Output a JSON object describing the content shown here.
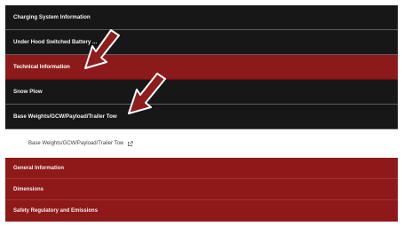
{
  "menu": {
    "items": [
      {
        "label": "Charging System Information"
      },
      {
        "label": "Under Hood Switched Battery ..."
      },
      {
        "label": "Technical Information"
      },
      {
        "label": "Snow Plow"
      },
      {
        "label": "Base Weights/GCW/Payload/Trailer Tow"
      }
    ]
  },
  "sublink": {
    "label": "Base Weights/GCW/Payload/Trailer Tow",
    "icon": "external-link-icon"
  },
  "sections": {
    "items": [
      {
        "label": "General Information"
      },
      {
        "label": "Dimensions"
      },
      {
        "label": "Safety Regulatory and Emissions"
      }
    ]
  },
  "annotations": {
    "arrow_color": "#8f1d1d",
    "arrow_outline": "#ffffff",
    "arrow_icon": "pointer-arrow-icon"
  },
  "colors": {
    "menu_bg": "#171717",
    "active_bg": "#8d1a1a",
    "sections_bg": "#8e1919"
  }
}
